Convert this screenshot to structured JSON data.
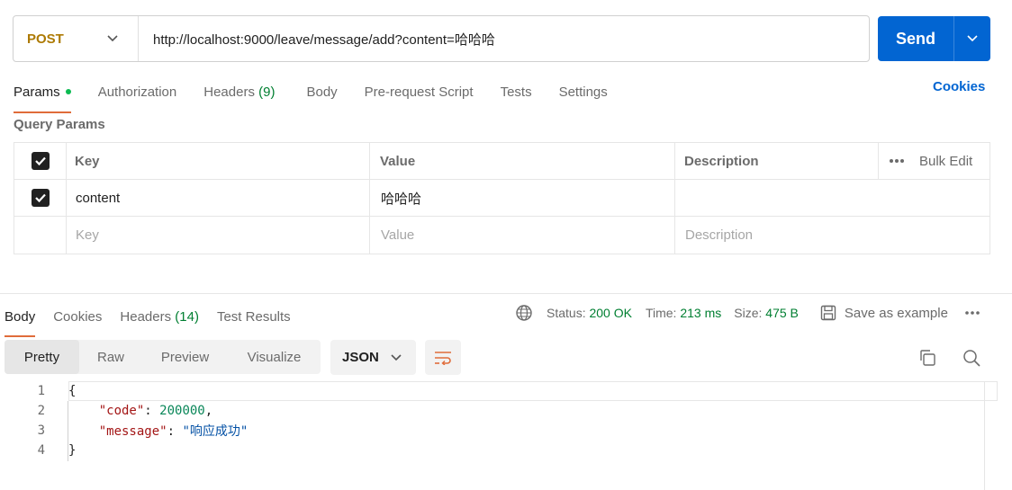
{
  "request": {
    "method": "POST",
    "url": "http://localhost:9000/leave/message/add?content=哈哈哈",
    "send_label": "Send"
  },
  "request_tabs": [
    {
      "label": "Params",
      "active": true
    },
    {
      "label": "Authorization"
    },
    {
      "label": "Headers",
      "count": "(9)"
    },
    {
      "label": "Body"
    },
    {
      "label": "Pre-request Script"
    },
    {
      "label": "Tests"
    },
    {
      "label": "Settings"
    }
  ],
  "cookies_link": "Cookies",
  "query_params": {
    "title": "Query Params",
    "headers": {
      "key": "Key",
      "value": "Value",
      "description": "Description",
      "bulk_edit": "Bulk Edit"
    },
    "rows": [
      {
        "checked": true,
        "key": "content",
        "value": "哈哈哈",
        "description": ""
      }
    ],
    "placeholder": {
      "key": "Key",
      "value": "Value",
      "description": "Description"
    }
  },
  "response_tabs": [
    {
      "label": "Body",
      "active": true
    },
    {
      "label": "Cookies"
    },
    {
      "label": "Headers",
      "count": "(14)"
    },
    {
      "label": "Test Results"
    }
  ],
  "response_meta": {
    "status_label": "Status:",
    "status_value": "200 OK",
    "time_label": "Time:",
    "time_value": "213 ms",
    "size_label": "Size:",
    "size_value": "475 B",
    "save_label": "Save as example"
  },
  "view_modes": [
    "Pretty",
    "Raw",
    "Preview",
    "Visualize"
  ],
  "active_view_mode": "Pretty",
  "format": "JSON",
  "code": {
    "line_numbers": [
      "1",
      "2",
      "3",
      "4"
    ],
    "open_brace": "{",
    "close_brace": "}",
    "code_key": "\"code\"",
    "code_value": "200000",
    "message_key": "\"message\"",
    "message_value": "\"响应成功\""
  },
  "colors": {
    "accent": "#0265d2",
    "method": "#ad7a03",
    "success": "#007f31",
    "tab_underline": "#e06c3a"
  },
  "icons": [
    "chevron-down-icon",
    "globe-icon",
    "save-icon",
    "more-icon",
    "copy-icon",
    "search-icon",
    "wrap-icon"
  ]
}
